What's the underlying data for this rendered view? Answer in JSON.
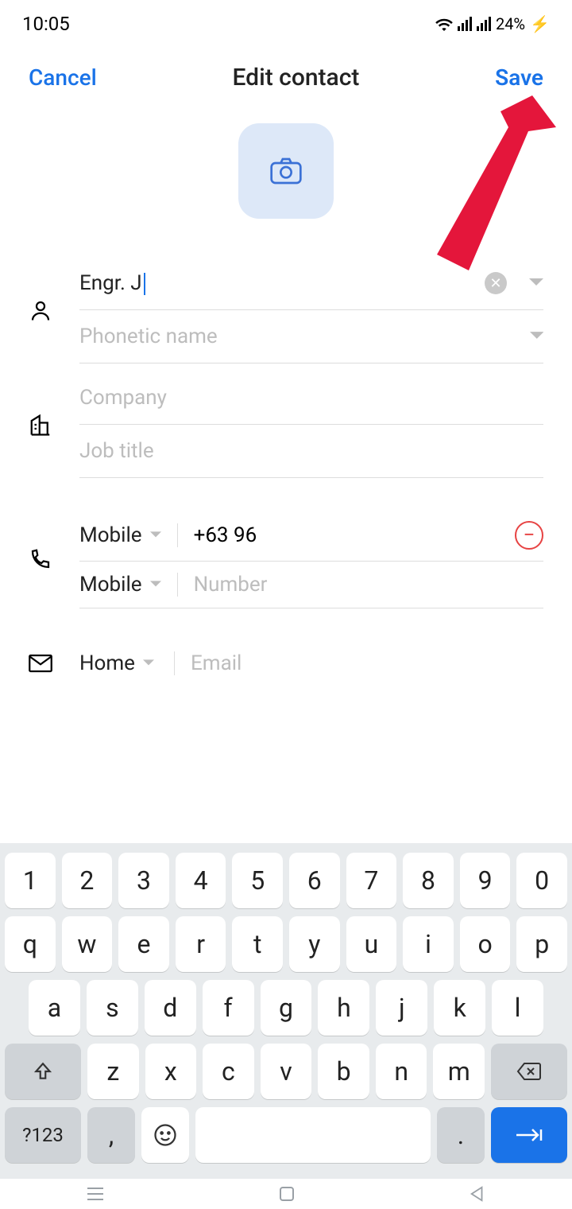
{
  "status": {
    "time": "10:05",
    "battery": "24%"
  },
  "header": {
    "cancel": "Cancel",
    "title": "Edit contact",
    "save": "Save"
  },
  "name": {
    "value": "Engr. J",
    "phonetic_placeholder": "Phonetic name"
  },
  "company": {
    "placeholder": "Company",
    "job_placeholder": "Job title"
  },
  "phones": [
    {
      "type": "Mobile",
      "number": "+63 96"
    },
    {
      "type": "Mobile",
      "number_placeholder": "Number"
    }
  ],
  "email": {
    "type": "Home",
    "placeholder": "Email"
  },
  "keyboard": {
    "row1": [
      "1",
      "2",
      "3",
      "4",
      "5",
      "6",
      "7",
      "8",
      "9",
      "0"
    ],
    "row2": [
      "q",
      "w",
      "e",
      "r",
      "t",
      "y",
      "u",
      "i",
      "o",
      "p"
    ],
    "row3": [
      "a",
      "s",
      "d",
      "f",
      "g",
      "h",
      "j",
      "k",
      "l"
    ],
    "row4": [
      "z",
      "x",
      "c",
      "v",
      "b",
      "n",
      "m"
    ],
    "symbols": "?123",
    "comma": ",",
    "period": "."
  }
}
